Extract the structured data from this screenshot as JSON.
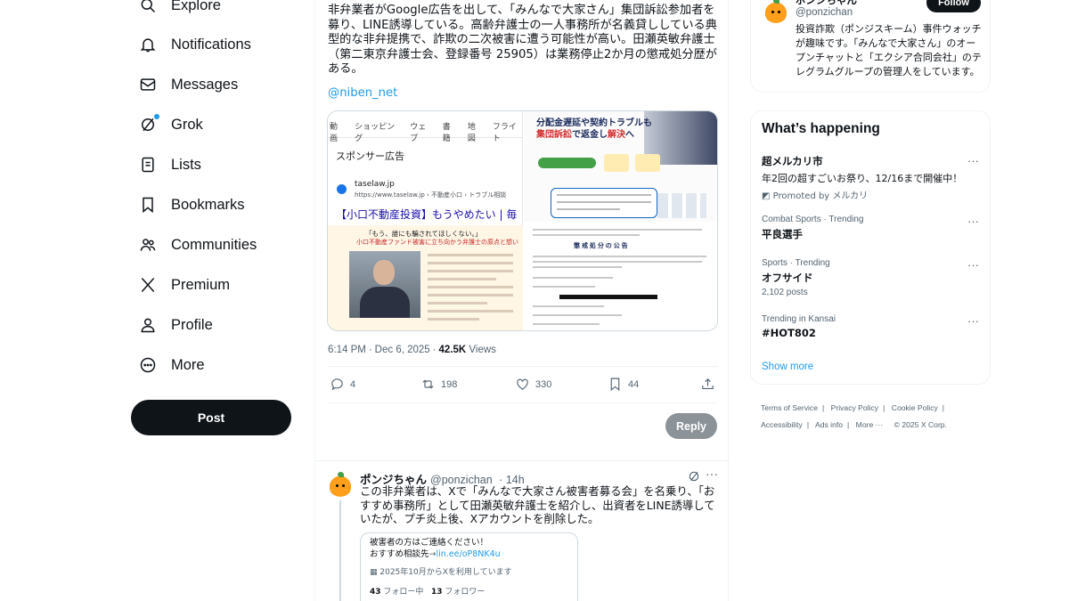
{
  "nav": {
    "items": [
      {
        "label": "Explore",
        "icon": "search-icon"
      },
      {
        "label": "Notifications",
        "icon": "bell-icon"
      },
      {
        "label": "Messages",
        "icon": "envelope-icon"
      },
      {
        "label": "Grok",
        "icon": "grok-icon"
      },
      {
        "label": "Lists",
        "icon": "list-icon"
      },
      {
        "label": "Bookmarks",
        "icon": "bookmark-icon"
      },
      {
        "label": "Communities",
        "icon": "people-icon"
      },
      {
        "label": "Premium",
        "icon": "x-logo-icon"
      },
      {
        "label": "Profile",
        "icon": "person-icon"
      },
      {
        "label": "More",
        "icon": "more-circle-icon"
      }
    ],
    "post_label": "Post"
  },
  "tweet": {
    "text": "非弁業者がGoogle広告を出して、「みんなで大家さん」集団訴訟参加者を募り、LINE誘導している。高齢弁護士の一人事務所が名義貸ししている典型的な非弁提携で、詐欺の二次被害に遭う可能性が高い。田瀬英敏弁護士（第二東京弁護士会、登録番号 25905）は業務停止2か月の懲戒処分歴がある。",
    "link": "@niben_net",
    "media": {
      "left": {
        "tabs": [
          "動画",
          "ショッピング",
          "ウェブ",
          "書籍",
          "地図",
          "フライト"
        ],
        "sponsor": "スポンサー広告",
        "site": "taselaw.jp",
        "url": "https://www.taselaw.jp › 不動産小口 › トラブル相談",
        "ad_title": "【小口不動産投資】もうやめたい | 毎",
        "banner_line1": "「もう、誰にも騙されてほしくない。」",
        "banner_line2": "小口不動産ファンド被害に立ち向かう弁護士の原点と想い"
      },
      "right": {
        "headline1": "分配金遅延や契約トラブルも",
        "headline2_red": "集団訴訟",
        "headline2_rest": "で返金し",
        "headline2_red2": "解決",
        "headline2_end": "へ",
        "doc_title": "懲 戒 処 分 の 公 告"
      }
    },
    "time": "6:14 PM",
    "date": "Dec 6, 2025",
    "views_count": "42.5K",
    "views_label": "Views",
    "actions": {
      "reply_count": "4",
      "retweet_count": "198",
      "like_count": "330",
      "bookmark_count": "44"
    },
    "reply_button": "Reply"
  },
  "reply": {
    "name": "ポンジちゃん",
    "handle": "@ponzichan",
    "time": "14h",
    "text": "この非弁業者は、Xで「みんなで大家さん被害者募る会」を名乗り、「おすすめ事務所」として田瀬英敏弁護士を紹介し、出資者をLINE誘導していたが、プチ炎上後、Xアカウントを削除した。",
    "card": {
      "line1": "被害者の方はご連絡ください！",
      "line2_prefix": "おすすめ相談先",
      "line2_link": "lin.ee/oP8NK4u",
      "line3": "2025年10月からXを利用しています",
      "following_count": "43",
      "following_label": "フォロー中",
      "followers_count": "13",
      "followers_label": "フォロワー"
    }
  },
  "profile_card": {
    "name": "ポンジちゃん",
    "handle": "@ponzichan",
    "follow_label": "Follow",
    "bio": "投資詐欺（ポンジスキーム）事件ウォッチが趣味です。「みんなで大家さん」のオープンチャットと「エクシア合同会社」のテレグラムグループの管理人をしています。"
  },
  "trends": {
    "title": "What’s happening",
    "items": [
      {
        "context": "",
        "title": "超メルカリ市",
        "desc": "年2回の超すごいお祭り、12/16まで開催中！",
        "promo": "Promoted by メルカリ",
        "posts": ""
      },
      {
        "context": "Combat Sports · Trending",
        "title": "平良選手",
        "desc": "",
        "promo": "",
        "posts": ""
      },
      {
        "context": "Sports · Trending",
        "title": "オフサイド",
        "desc": "",
        "promo": "",
        "posts": "2,102 posts"
      },
      {
        "context": "Trending in Kansai",
        "title": "#HOT802",
        "desc": "",
        "promo": "",
        "posts": ""
      }
    ],
    "show_more": "Show more"
  },
  "footer": {
    "links": [
      "Terms of Service",
      "Privacy Policy",
      "Cookie Policy",
      "Accessibility",
      "Ads info",
      "More ···"
    ],
    "copyright": "© 2025 X Corp."
  },
  "colors": {
    "accent": "#1d9bf0",
    "text": "#0f1419",
    "muted": "#536471",
    "border": "#eff3f4"
  }
}
